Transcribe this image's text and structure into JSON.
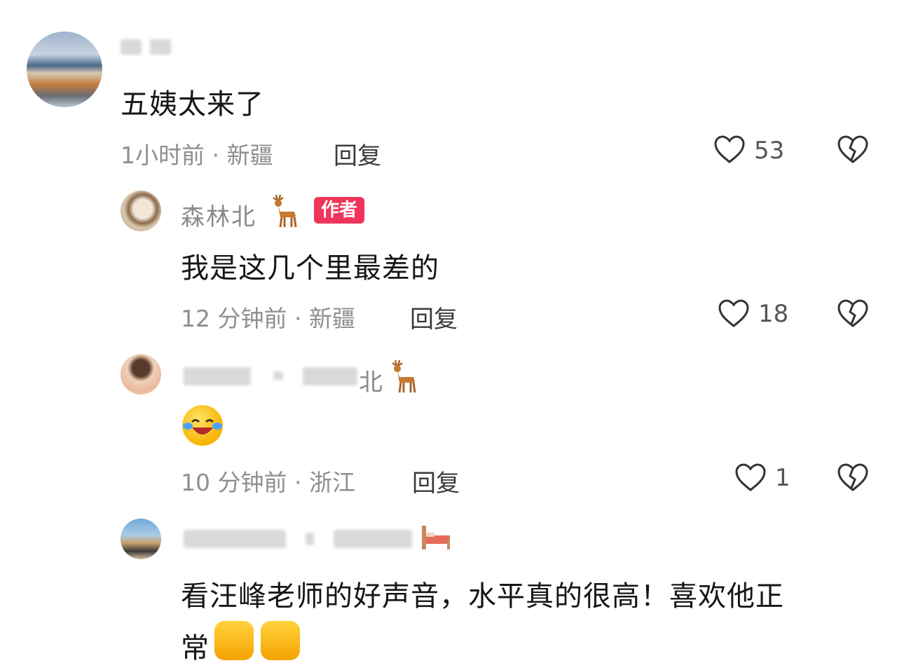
{
  "comments": [
    {
      "text": "五姨太来了",
      "time": "1小时前",
      "location": "新疆",
      "reply_label": "回复",
      "likes": "53"
    },
    {
      "author": "森林北",
      "badge": "作者",
      "text": "我是这几个里最差的",
      "time": "12 分钟前",
      "location": "新疆",
      "reply_label": "回复",
      "likes": "18"
    },
    {
      "author_suffix": "北",
      "text": "",
      "time": "10 分钟前",
      "location": "浙江",
      "reply_label": "回复",
      "likes": "1"
    },
    {
      "text_line1": "看汪峰老师的好声音，水平真的很高！喜欢他正",
      "text_line2": "常"
    }
  ],
  "separator": "·",
  "icons": {
    "like": "heart-outline-icon",
    "dislike": "broken-heart-icon",
    "author_emoji": "deer-emoji",
    "reaction_emoji": "tears-of-joy-emoji",
    "thumbs_emoji": "thumbs-up-emoji"
  },
  "colors": {
    "badge": "#f0345a",
    "meta_text": "#8e8e93"
  }
}
